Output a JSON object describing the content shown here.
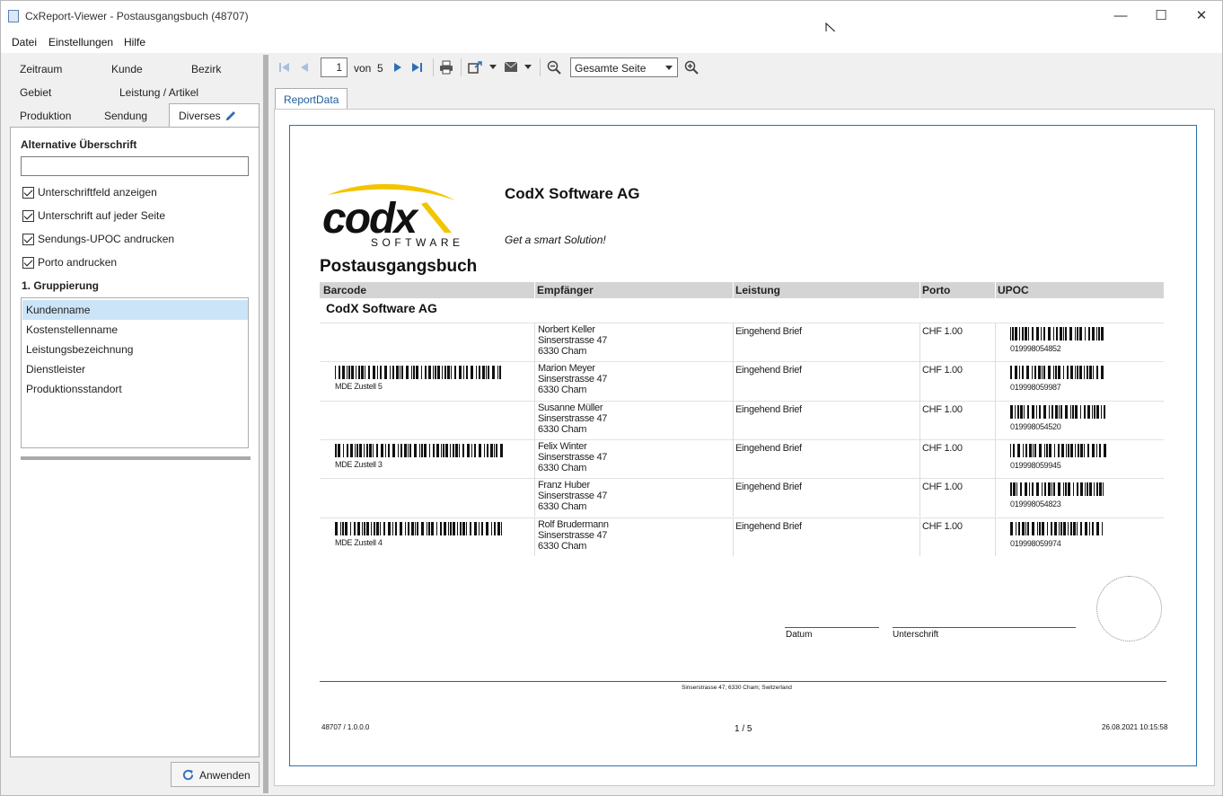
{
  "window": {
    "title": "CxReport-Viewer - Postausgangsbuch (48707)",
    "minimize": "—",
    "maximize": "☐",
    "close": "✕"
  },
  "menu": [
    "Datei",
    "Einstellungen",
    "Hilfe"
  ],
  "left_tabs": {
    "row1": [
      "Zeitraum",
      "Kunde",
      "Bezirk"
    ],
    "row2": [
      "Gebiet",
      "Leistung / Artikel"
    ],
    "row3": [
      "Produktion",
      "Sendung"
    ],
    "active": "Diverses"
  },
  "panel": {
    "alt_heading_label": "Alternative Überschrift",
    "alt_heading_value": "",
    "checkboxes": [
      {
        "label": "Unterschriftfeld anzeigen",
        "checked": true
      },
      {
        "label": "Unterschrift auf jeder Seite",
        "checked": true
      },
      {
        "label": "Sendungs-UPOC andrucken",
        "checked": true
      },
      {
        "label": "Porto andrucken",
        "checked": true
      }
    ],
    "grouping_label": "1. Gruppierung",
    "grouping_options": [
      "Kundenname",
      "Kostenstellenname",
      "Leistungsbezeichnung",
      "Dienstleister",
      "Produktionsstandort"
    ],
    "grouping_selected": "Kundenname",
    "apply_label": "Anwenden"
  },
  "toolbar": {
    "page": "1",
    "of_label": "von",
    "total_pages": "5",
    "zoom_value": "Gesamte Seite"
  },
  "doc_tab": "ReportData",
  "report": {
    "company": "CodX Software AG",
    "slogan": "Get a smart Solution!",
    "logo_text": "codx",
    "logo_sub": "SOFTWARE",
    "title": "Postausgangsbuch",
    "columns": [
      "Barcode",
      "Empfänger",
      "Leistung",
      "Porto",
      "UPOC"
    ],
    "group_header": "CodX Software AG",
    "rows": [
      {
        "barcode_label": "",
        "name": "Norbert Keller",
        "street": "Sinserstrasse 47",
        "city": "6330 Cham",
        "service": "Eingehend Brief",
        "porto": "CHF 1.00",
        "upoc": "019998054852"
      },
      {
        "barcode_label": "MDE Zustell 5",
        "name": "Marion Meyer",
        "street": "Sinserstrasse 47",
        "city": "6330 Cham",
        "service": "Eingehend Brief",
        "porto": "CHF 1.00",
        "upoc": "019998059987"
      },
      {
        "barcode_label": "",
        "name": "Susanne Müller",
        "street": "Sinserstrasse 47",
        "city": "6330 Cham",
        "service": "Eingehend Brief",
        "porto": "CHF 1.00",
        "upoc": "019998054520"
      },
      {
        "barcode_label": "MDE Zustell 3",
        "name": "Felix Winter",
        "street": "Sinserstrasse 47",
        "city": "6330 Cham",
        "service": "Eingehend Brief",
        "porto": "CHF 1.00",
        "upoc": "019998059945"
      },
      {
        "barcode_label": "",
        "name": "Franz Huber",
        "street": "Sinserstrasse 47",
        "city": "6330 Cham",
        "service": "Eingehend Brief",
        "porto": "CHF 1.00",
        "upoc": "019998054823"
      },
      {
        "barcode_label": "MDE Zustell 4",
        "name": "Rolf Brudermann",
        "street": "Sinserstrasse 47",
        "city": "6330 Cham",
        "service": "Eingehend Brief",
        "porto": "CHF 1.00",
        "upoc": "019998059974"
      }
    ],
    "sig_date_label": "Datum",
    "sig_label": "Unterschrift",
    "address_footer": "Sinserstrasse 47; 6330 Cham; Switzerland",
    "footer_left": "48707 / 1.0.0.0",
    "footer_center": "1 / 5",
    "footer_right": "26.08.2021  10:15:58"
  }
}
